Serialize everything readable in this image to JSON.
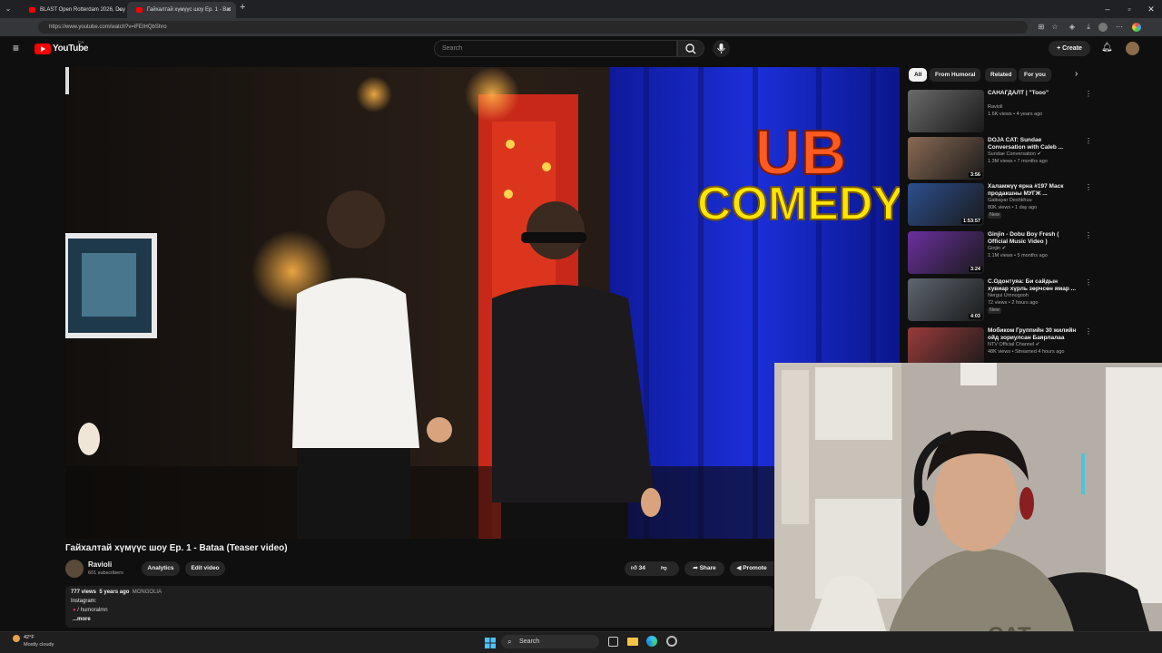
{
  "browser": {
    "tabs": [
      {
        "label": "BLAST Open Rotterdam 2026, Day"
      },
      {
        "label": "Гайхалтай хүмүүс шоу Ep. 1 - Bat"
      }
    ],
    "url": "https://www.youtube.com/watch?v=lFEtHQbShro",
    "new_tab_label": "+"
  },
  "youtube": {
    "logo_text": "YouTube",
    "country_code": "CA",
    "search_placeholder": "Search",
    "create_label": "Create"
  },
  "video": {
    "title": "Гайхалтай хүмүүс шоу Ep. 1 - Bataa (Teaser video)",
    "sign_line1": "UB",
    "sign_line2": "COMEDY",
    "channel": "Ravioli",
    "subscribers": "601 subscribers",
    "analytics_label": "Analytics",
    "edit_label": "Edit video",
    "likes": "34",
    "share_label": "Share",
    "promote_label": "Promote",
    "views": "777 views",
    "age": "5 years ago",
    "tag": "MONGOLIA",
    "desc_line": "Instagram:",
    "handle": "/ humoralmn",
    "more_label": "...more"
  },
  "filters": [
    "All",
    "From Humoral",
    "Related",
    "For you"
  ],
  "recommendations": [
    {
      "title": "САНАГДАЛТ | \"Tooo\"",
      "channel": "Ravioli",
      "meta": "1.6K views • 4 years ago",
      "duration": "",
      "verified": false,
      "badge": "",
      "color": "#6a6a6a"
    },
    {
      "title": "DOJA CAT: Sundae Conversation with Caleb ...",
      "channel": "Sundae Conversation",
      "meta": "1.3M views • 7 months ago",
      "duration": "3:56",
      "verified": true,
      "badge": "",
      "color": "#8a6a55"
    },
    {
      "title": "Халамжүү ярна #197 Маск продакшны МУГЖ ...",
      "channel": "Galbayar Deshkhuu",
      "meta": "80K views • 1 day ago",
      "duration": "1:53:57",
      "verified": false,
      "badge": "New",
      "color": "#2c4f8e"
    },
    {
      "title": "Ginjin - Dobu Boy Fresh ( Official Music Video )",
      "channel": "Ginjin",
      "meta": "1.1M views • 5 months ago",
      "duration": "3:24",
      "verified": true,
      "badge": "",
      "color": "#6b2fa0"
    },
    {
      "title": "С.Одонтуяа: Би сайдын хувиар хүрль зөрчсөн ямар ...",
      "channel": "Nergui Urnnogooh",
      "meta": "72 views • 2 hours ago",
      "duration": "4:03",
      "verified": false,
      "badge": "New",
      "color": "#5e6670"
    },
    {
      "title": "Мобиком Группийн 30 жилийн ойд зориулсан Баярлалаа",
      "channel": "NTV Official Channel",
      "meta": "48K views • Streamed 4 hours ago",
      "duration": "",
      "verified": true,
      "badge": "",
      "color": "#9a3b3b"
    }
  ],
  "taskbar": {
    "weather_temp": "42°F",
    "weather_desc": "Mostly cloudy",
    "search_label": "Search"
  },
  "colors": {
    "accent": "#ff0000",
    "background": "#0f0f0f",
    "sign_red": "#ff5a1f",
    "sign_yellow": "#ffe600",
    "curtain_blue": "#1b2fd8"
  }
}
